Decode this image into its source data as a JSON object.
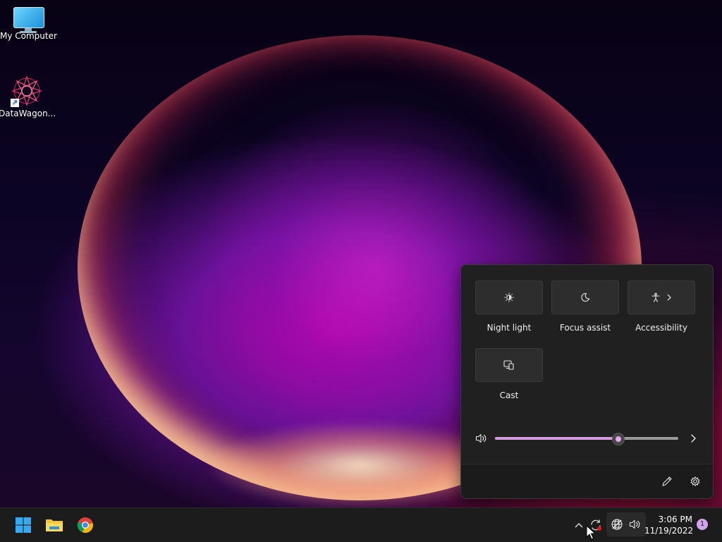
{
  "desktop": {
    "icons": [
      {
        "label": "My Computer",
        "icon": "monitor-icon"
      },
      {
        "label": "DataWagon...",
        "icon": "datawagon-app-icon"
      }
    ]
  },
  "quick_settings": {
    "tiles": [
      {
        "label": "Night light",
        "icon": "night-light-icon"
      },
      {
        "label": "Focus assist",
        "icon": "moon-icon"
      },
      {
        "label": "Accessibility",
        "icon": "accessibility-icon",
        "has_chevron": true
      },
      {
        "label": "Cast",
        "icon": "cast-icon"
      }
    ],
    "volume": {
      "icon": "speaker-icon",
      "level_fraction": 0.67
    },
    "footer": {
      "edit_icon": "pencil-icon",
      "settings_icon": "gear-icon"
    },
    "accent_color": "#d69ae0"
  },
  "taskbar": {
    "apps": [
      {
        "name": "Start",
        "icon": "windows-logo-icon"
      },
      {
        "name": "File Explorer",
        "icon": "folder-icon"
      },
      {
        "name": "Google Chrome",
        "icon": "chrome-icon"
      }
    ],
    "tray": {
      "icons": [
        "chevron-up-icon",
        "sync-icon",
        "network-icon",
        "speaker-icon"
      ]
    },
    "clock": {
      "time": "3:06 PM",
      "date": "11/19/2022"
    },
    "notification_count": "1"
  }
}
